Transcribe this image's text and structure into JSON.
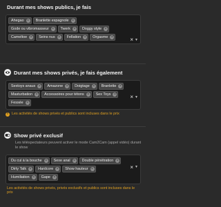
{
  "public_shows": {
    "title": "Durant mes shows publics, je fais",
    "tags": [
      "Ahegao",
      "Branlette espagnole",
      "Gode ou vibromasseur",
      "Twerk",
      "Doggy style",
      "Cameltoe",
      "Seins nus",
      "Fellation",
      "Orgasme"
    ]
  },
  "private_shows": {
    "title": "Durant mes shows privés, je fais également",
    "tags": [
      "Sextoys anaux",
      "Amazone",
      "Doigtage",
      "Branlette",
      "Masturbation",
      "Accessoires pour tétons",
      "Sex Toys",
      "Fessée"
    ],
    "note": "Les activités de shows privés et publics sont incluses dans le prix"
  },
  "exclusive_show": {
    "title": "Show privé exclusif",
    "description": "Les téléspectateurs peuvent activer le mode Cam2Cam (appel vidéo) durant le show",
    "tags": [
      "Du cul à la bouche",
      "Sexe anal",
      "Double pénétration",
      "Dirty Talk",
      "Hardcore",
      "Show hauteur",
      "Humiliation",
      "Gape"
    ],
    "note": "Les activités de shows privés, privés exclusifs et publics sont incluses dans le prix"
  },
  "controls": {
    "clear": "×",
    "dropdown": "▼",
    "tag_remove": "×",
    "info": "i"
  },
  "colors": {
    "background": "#2a2a2a",
    "note": "#e0a020"
  },
  "icons": {
    "private": "eye-icon",
    "exclusive": "toggle-icon"
  }
}
